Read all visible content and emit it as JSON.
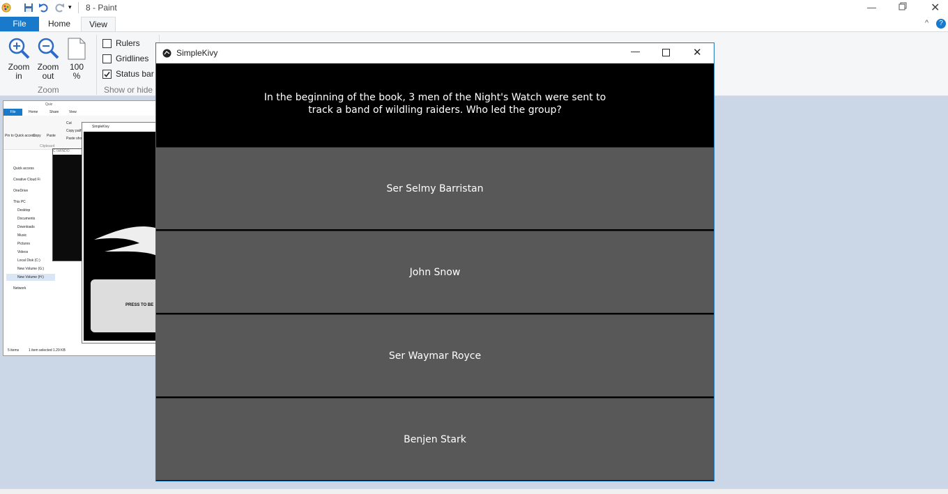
{
  "paint": {
    "title": "8 - Paint",
    "tabs": {
      "file": "File",
      "home": "Home",
      "view": "View"
    },
    "zoom": {
      "zoom_in_line1": "Zoom",
      "zoom_in_line2": "in",
      "zoom_out_line1": "Zoom",
      "zoom_out_line2": "out",
      "percent_line1": "100",
      "percent_line2": "%",
      "group": "Zoom"
    },
    "show_hide": {
      "rulers": "Rulers",
      "rulers_checked": false,
      "gridlines": "Gridlines",
      "gridlines_checked": false,
      "status_bar": "Status bar",
      "status_bar_checked": true,
      "group": "Show or hide"
    }
  },
  "pasted": {
    "explorer_title": "Quiz",
    "tabs": [
      "File",
      "Home",
      "Share",
      "View"
    ],
    "ribbon": [
      "Pin to Quick access",
      "Copy",
      "Paste",
      "Cut",
      "Copy path",
      "Paste shortcut",
      "Clipboard"
    ],
    "console_title": "C:\\WINDO",
    "kivy_title": "SimpleKivy",
    "press_label": "PRESS TO BE",
    "nav": [
      "Quick access",
      "Creative Cloud Fi",
      "OneDrive",
      "This PC",
      "Desktop",
      "Documents",
      "Downloads",
      "Music",
      "Pictures",
      "Videos",
      "Local Disk (C:)",
      "New Volume (G:)",
      "New Volume (H:)",
      "Network"
    ],
    "status": [
      "5 items",
      "1 item selected  1.29 KB"
    ]
  },
  "kivy": {
    "title": "SimpleKivy",
    "question": "In the beginning of the book, 3 men of the Night's Watch were sent to\n track a band of wildling raiders. Who led the group?",
    "answers": [
      "Ser Selmy Barristan",
      "John Snow",
      "Ser Waymar Royce",
      "Benjen Stark"
    ]
  },
  "colors": {
    "accent": "#1e73be",
    "answer_bg": "#585858",
    "canvas_bg": "#cbd7e6"
  }
}
